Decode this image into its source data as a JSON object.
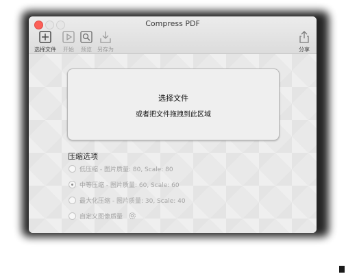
{
  "window": {
    "title": "Compress PDF"
  },
  "toolbar": {
    "select_file": {
      "label": "选择文件",
      "icon": "plus-square-icon"
    },
    "start": {
      "label": "开始",
      "icon": "play-icon"
    },
    "preview": {
      "label": "预览",
      "icon": "magnifier-icon"
    },
    "save_as": {
      "label": "另存为",
      "icon": "download-icon"
    },
    "share": {
      "label": "分享",
      "icon": "share-icon"
    }
  },
  "dropzone": {
    "line1": "选择文件",
    "line2": "或者把文件拖拽到此区域"
  },
  "compression": {
    "title": "压缩选项",
    "options": [
      {
        "label": "低压缩 - 图片质量: 80, Scale: 80",
        "selected": false
      },
      {
        "label": "中等压缩 - 图片质量: 60, Scale: 60",
        "selected": true
      },
      {
        "label": "最大化压缩 - 图片质量: 30, Scale: 40",
        "selected": false
      },
      {
        "label": "自定义图像质量",
        "selected": false
      }
    ]
  },
  "colors": {
    "close": "#fc5f57",
    "window_bg": "#e9e9e9",
    "disabled_text": "#a2a2a2"
  }
}
